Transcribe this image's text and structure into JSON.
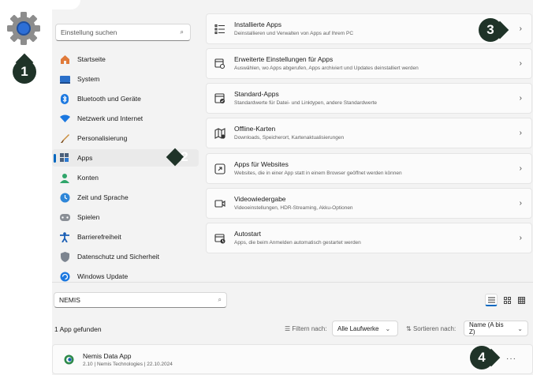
{
  "badges": {
    "b1": "1",
    "b2": "2",
    "b3": "3",
    "b4": "4"
  },
  "search": {
    "placeholder": "Einstellung suchen"
  },
  "nav": {
    "items": [
      {
        "label": "Startseite",
        "icon": "home-icon"
      },
      {
        "label": "System",
        "icon": "monitor-icon"
      },
      {
        "label": "Bluetooth und Geräte",
        "icon": "bluetooth-icon"
      },
      {
        "label": "Netzwerk und Internet",
        "icon": "network-icon"
      },
      {
        "label": "Personalisierung",
        "icon": "brush-icon"
      },
      {
        "label": "Apps",
        "icon": "apps-icon"
      },
      {
        "label": "Konten",
        "icon": "user-icon"
      },
      {
        "label": "Zeit und Sprache",
        "icon": "globe-clock-icon"
      },
      {
        "label": "Spielen",
        "icon": "gamepad-icon"
      },
      {
        "label": "Barrierefreiheit",
        "icon": "accessibility-icon"
      },
      {
        "label": "Datenschutz und Sicherheit",
        "icon": "shield-icon"
      },
      {
        "label": "Windows Update",
        "icon": "update-icon"
      }
    ]
  },
  "cards": [
    {
      "title": "Installierte Apps",
      "subtitle": "Deinstallieren und Verwalten von Apps auf Ihrem PC",
      "icon": "list-icon"
    },
    {
      "title": "Erweiterte Einstellungen für Apps",
      "subtitle": "Auswählen, wo Apps abgerufen, Apps archiviert und Updates deinstalliert werden",
      "icon": "app-settings-icon"
    },
    {
      "title": "Standard-Apps",
      "subtitle": "Standardwerte für Datei- und Linktypen, andere Standardwerte",
      "icon": "default-apps-icon"
    },
    {
      "title": "Offline-Karten",
      "subtitle": "Downloads, Speicherort, Kartenaktualisierungen",
      "icon": "map-icon"
    },
    {
      "title": "Apps für Websites",
      "subtitle": "Websites, die in einer App statt in einem Browser geöffnet werden können",
      "icon": "web-app-icon"
    },
    {
      "title": "Videowiedergabe",
      "subtitle": "Videoeinstellungen, HDR-Streaming, Akku-Optionen",
      "icon": "video-icon"
    },
    {
      "title": "Autostart",
      "subtitle": "Apps, die beim Anmelden automatisch gestartet werden",
      "icon": "startup-icon"
    }
  ],
  "lower": {
    "search_value": "NEMIS",
    "count": "1 App gefunden",
    "filter_label": "Filtern nach:",
    "filter_value": "Alle Laufwerke",
    "sort_label": "Sortieren nach:",
    "sort_value": "Name (A bis Z)"
  },
  "app": {
    "name": "Nemis Data App",
    "meta": "2.10  |  Nemis Technologies  |  22.10.2024",
    "more": "···"
  },
  "colors": {
    "accent": "#0067c0",
    "badge": "#1f3328"
  }
}
